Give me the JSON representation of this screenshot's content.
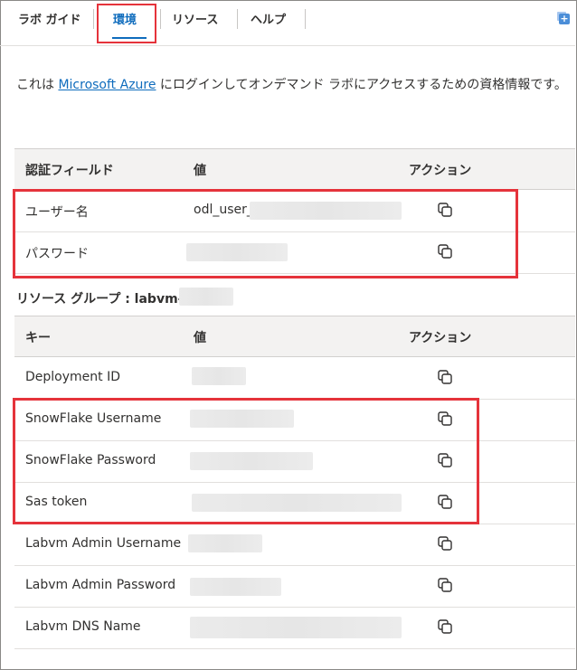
{
  "tabs": [
    {
      "label": "ラボ ガイド"
    },
    {
      "label": "環境"
    },
    {
      "label": "リソース"
    },
    {
      "label": "ヘルプ"
    }
  ],
  "intro": {
    "before": "これは ",
    "link": "Microsoft Azure",
    "after": " にログインしてオンデマンド ラボにアクセスするための資格情報です。"
  },
  "credentials": {
    "headers": {
      "field": "認証フィールド",
      "value": "値",
      "action": "アクション"
    },
    "rows": [
      {
        "label": "ユーザー名",
        "value": "odl_user_"
      },
      {
        "label": "パスワード",
        "value": ""
      }
    ]
  },
  "resource_group": {
    "label": "リソース グループ : labvm-"
  },
  "keys": {
    "headers": {
      "key": "キー",
      "value": "値",
      "action": "アクション"
    },
    "rows": [
      {
        "label": "Deployment ID"
      },
      {
        "label": "SnowFlake Username"
      },
      {
        "label": "SnowFlake Password"
      },
      {
        "label": "Sas token"
      },
      {
        "label": "Labvm Admin Username"
      },
      {
        "label": "Labvm Admin Password"
      },
      {
        "label": "Labvm DNS Name"
      }
    ]
  },
  "colors": {
    "accent": "#0f6cbd",
    "highlight": "#e5333b"
  },
  "icons": {
    "copy": "copy-icon",
    "add": "add-window-icon"
  }
}
